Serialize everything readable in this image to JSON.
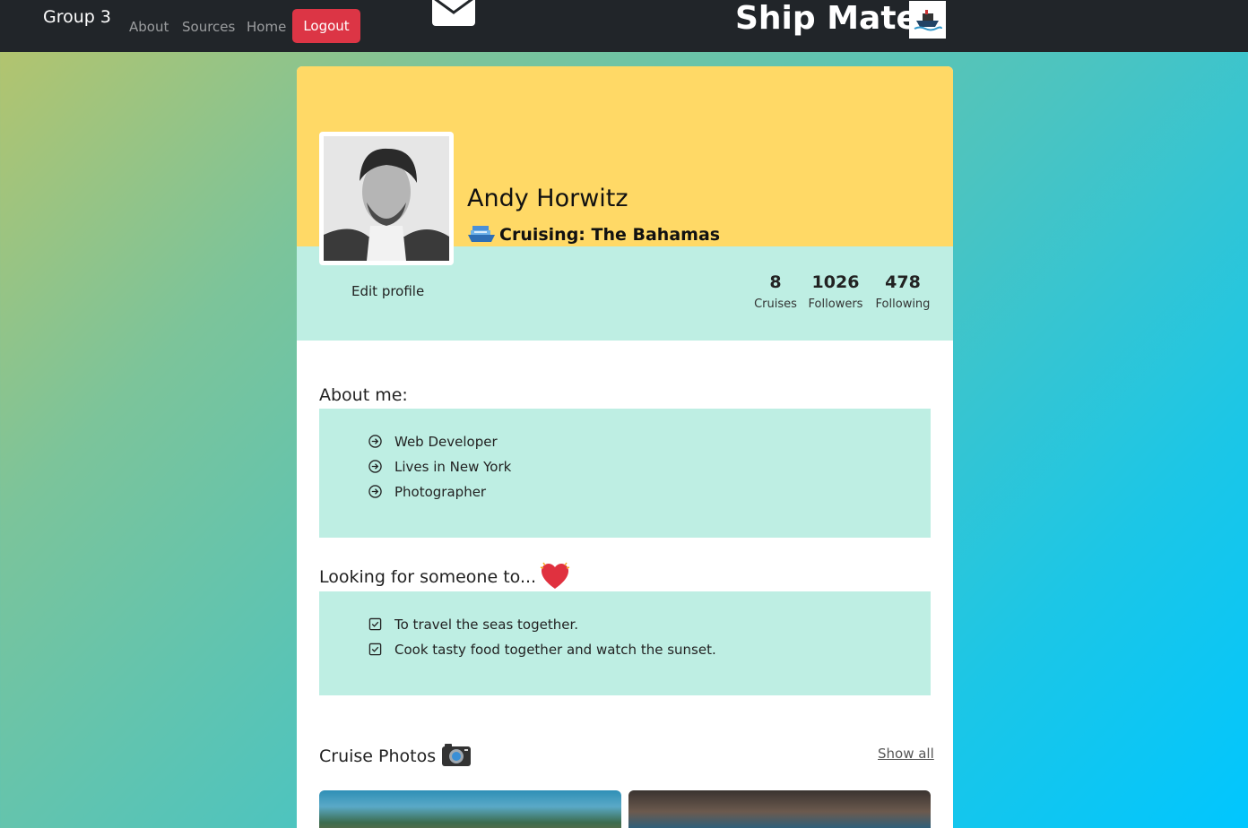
{
  "navbar": {
    "brand": "Group 3",
    "links": [
      "About",
      "Sources",
      "Home"
    ],
    "logout_label": "Logout",
    "app_title": "Ship Mate"
  },
  "profile": {
    "name": "Andy Horwitz",
    "cruising": "Cruising: The Bahamas",
    "edit_label": "Edit profile",
    "stats": [
      {
        "value": "8",
        "label": "Cruises"
      },
      {
        "value": "1026",
        "label": "Followers"
      },
      {
        "value": "478",
        "label": "Following"
      }
    ]
  },
  "about": {
    "heading": "About me:",
    "items": [
      "Web Developer",
      "Lives in New York",
      "Photographer"
    ]
  },
  "looking": {
    "heading": "Looking for someone to...",
    "items": [
      "To travel the seas together.",
      "Cook tasty food together and watch the sunset."
    ]
  },
  "photos": {
    "heading": "Cruise Photos",
    "show_all_label": "Show all"
  },
  "colors": {
    "navbar": "#212529",
    "logout": "#dc3545",
    "cover": "#ffd966",
    "band": "#beeee3"
  }
}
